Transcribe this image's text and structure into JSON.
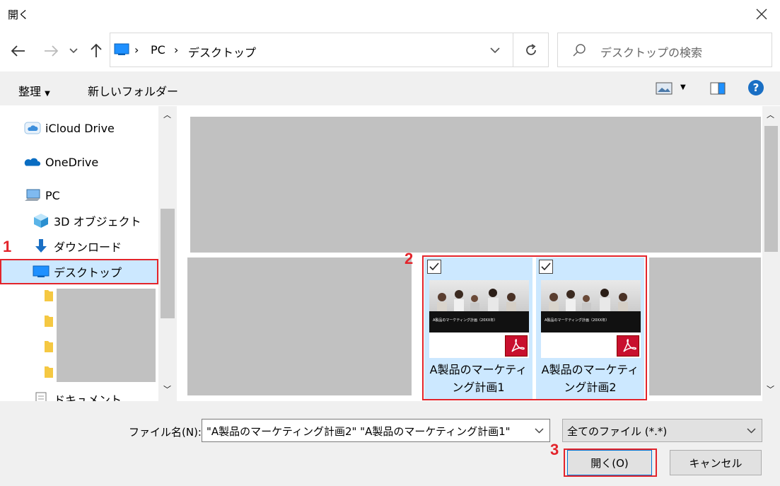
{
  "window": {
    "title": "開く"
  },
  "navigation": {
    "breadcrumb": [
      "PC",
      "デスクトップ"
    ],
    "search_placeholder": "デスクトップの検索"
  },
  "toolbar": {
    "organize": "整理",
    "new_folder": "新しいフォルダー"
  },
  "sidebar": {
    "items": [
      {
        "label": "iCloud Drive",
        "icon": "icloud-icon"
      },
      {
        "label": "OneDrive",
        "icon": "onedrive-icon"
      },
      {
        "label": "PC",
        "icon": "pc-icon"
      },
      {
        "label": "3D オブジェクト",
        "icon": "3d-objects-icon"
      },
      {
        "label": "ダウンロード",
        "icon": "download-icon"
      },
      {
        "label": "デスクトップ",
        "icon": "desktop-icon",
        "selected": true
      },
      {
        "label": "ドキュメント",
        "icon": "documents-icon"
      }
    ]
  },
  "files": [
    {
      "name_line1": "A製品のマーケティ",
      "name_line2": "ング計画1",
      "thumb_title": "A製品のマーケティング計画（20XX年）",
      "icon": "pdf-icon",
      "selected": true
    },
    {
      "name_line1": "A製品のマーケティ",
      "name_line2": "ング計画2",
      "thumb_title": "A製品のマーケティング計画（20XX年）",
      "icon": "pdf-icon",
      "selected": true
    }
  ],
  "footer": {
    "filename_label": "ファイル名(N):",
    "filename_value": "\"A製品のマーケティング計画2\" \"A製品のマーケティング計画1\"",
    "filetype": "全てのファイル (*.*)",
    "open_button": "開く(O)",
    "cancel_button": "キャンセル"
  },
  "annotations": {
    "step1": "1",
    "step2": "2",
    "step3": "3"
  },
  "colors": {
    "highlight": "#e3242b",
    "selection": "#cce8ff",
    "accent": "#0078d7"
  }
}
